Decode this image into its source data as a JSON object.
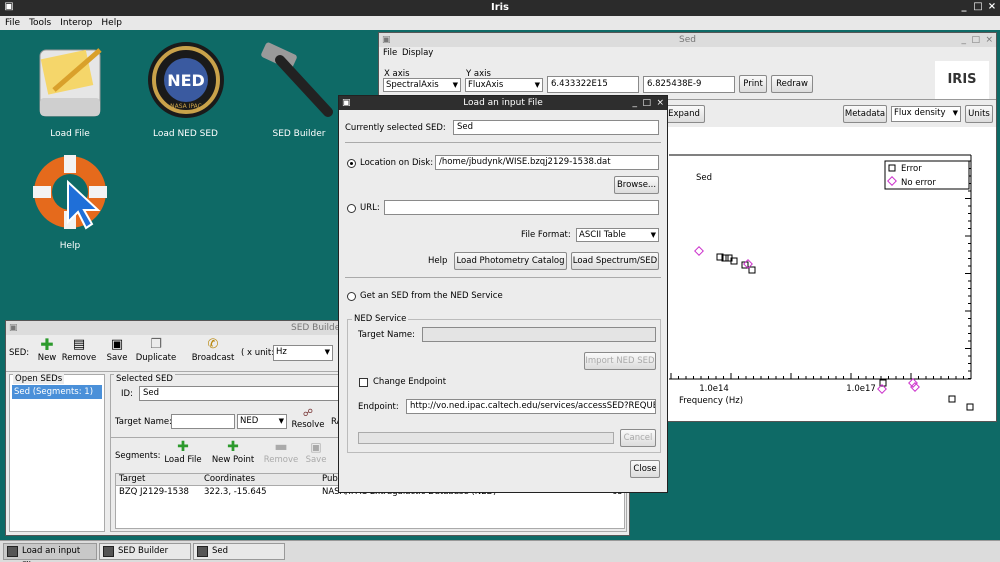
{
  "app": {
    "title": "Iris",
    "menu": [
      "File",
      "Tools",
      "Interop",
      "Help"
    ]
  },
  "desktop": {
    "icons": [
      {
        "name": "load-file",
        "label": "Load File"
      },
      {
        "name": "load-ned-sed",
        "label": "Load NED SED"
      },
      {
        "name": "sed-builder",
        "label": "SED Builder"
      },
      {
        "name": "help",
        "label": "Help"
      }
    ],
    "ned_logo_text": "NED",
    "ned_logo_sub": "NASA IPAC"
  },
  "sed_window": {
    "title": "Sed",
    "menu": [
      "File",
      "Display"
    ],
    "x_axis_label": "X axis",
    "y_axis_label": "Y axis",
    "x_axis_value": "SpectralAxis",
    "y_axis_value": "FluxAxis",
    "x_coord": "6.433322E15",
    "y_coord": "6.825438E-9",
    "print_label": "Print",
    "redraw_label": "Redraw",
    "logo": "IRIS",
    "expand_label": "Expand",
    "metadata_label": "Metadata",
    "flux_value": "Flux density",
    "units_label": "Units",
    "plot_title": "Sed",
    "legend": [
      "Error",
      "No error"
    ],
    "x_ticks": [
      "1.0e14",
      "1.0e17"
    ],
    "xlabel": "Frequency (Hz)"
  },
  "dialog": {
    "title": "Load an input File",
    "current_sed_label": "Currently selected SED:",
    "current_sed_value": "Sed",
    "location_label": "Location on Disk:",
    "location_value": "/home/jbudynk/WISE.bzqj2129-1538.dat",
    "browse_label": "Browse...",
    "url_label": "URL:",
    "url_value": "",
    "format_label": "File Format:",
    "format_value": "ASCII Table",
    "help_label": "Help",
    "load_photometry_label": "Load Photometry Catalog",
    "load_spectrum_label": "Load Spectrum/SED",
    "ned_radio_label": "Get an SED from the NED Service",
    "ned_service_label": "NED Service",
    "target_name_label": "Target Name:",
    "target_name_value": "",
    "import_ned_label": "Import NED SED",
    "change_endpoint_label": "Change Endpoint",
    "endpoint_label": "Endpoint:",
    "endpoint_value": "http://vo.ned.ipac.caltech.edu/services/accessSED?REQUES",
    "cancel_label": "Cancel",
    "close_label": "Close"
  },
  "builder": {
    "title": "SED Builder",
    "sed_label": "SED:",
    "tools": [
      "New",
      "Remove",
      "Save",
      "Duplicate",
      "Broadcast"
    ],
    "x_unit_label": "( x unit:",
    "x_unit_value": "Hz",
    "open_seds_label": "Open SEDs",
    "open_seds_items": [
      "Sed (Segments: 1)"
    ],
    "selected_sed_label": "Selected SED",
    "id_label": "ID:",
    "id_value": "Sed",
    "target_name_label": "Target Name:",
    "target_name_value": "",
    "ned_select": "NED",
    "resolve_label": "Resolve",
    "ra_label": "RA",
    "segments_label": "Segments:",
    "segment_tools": [
      "Load File",
      "New Point",
      "Remove",
      "Save"
    ],
    "columns": [
      "Target",
      "Coordinates",
      "Publ"
    ],
    "rows": [
      [
        "BZQ J2129-1538",
        "322.3, -15.645",
        "NASA/IPAC Extragalactic Database (NED)"
      ]
    ],
    "extra_num": "65"
  },
  "taskbar": {
    "items": [
      "Load an input File",
      "SED Builder",
      "Sed"
    ]
  },
  "colors": {
    "desktop": "#0e6a66",
    "error_marker": "#000000",
    "no_error_marker": "#cc33cc"
  }
}
